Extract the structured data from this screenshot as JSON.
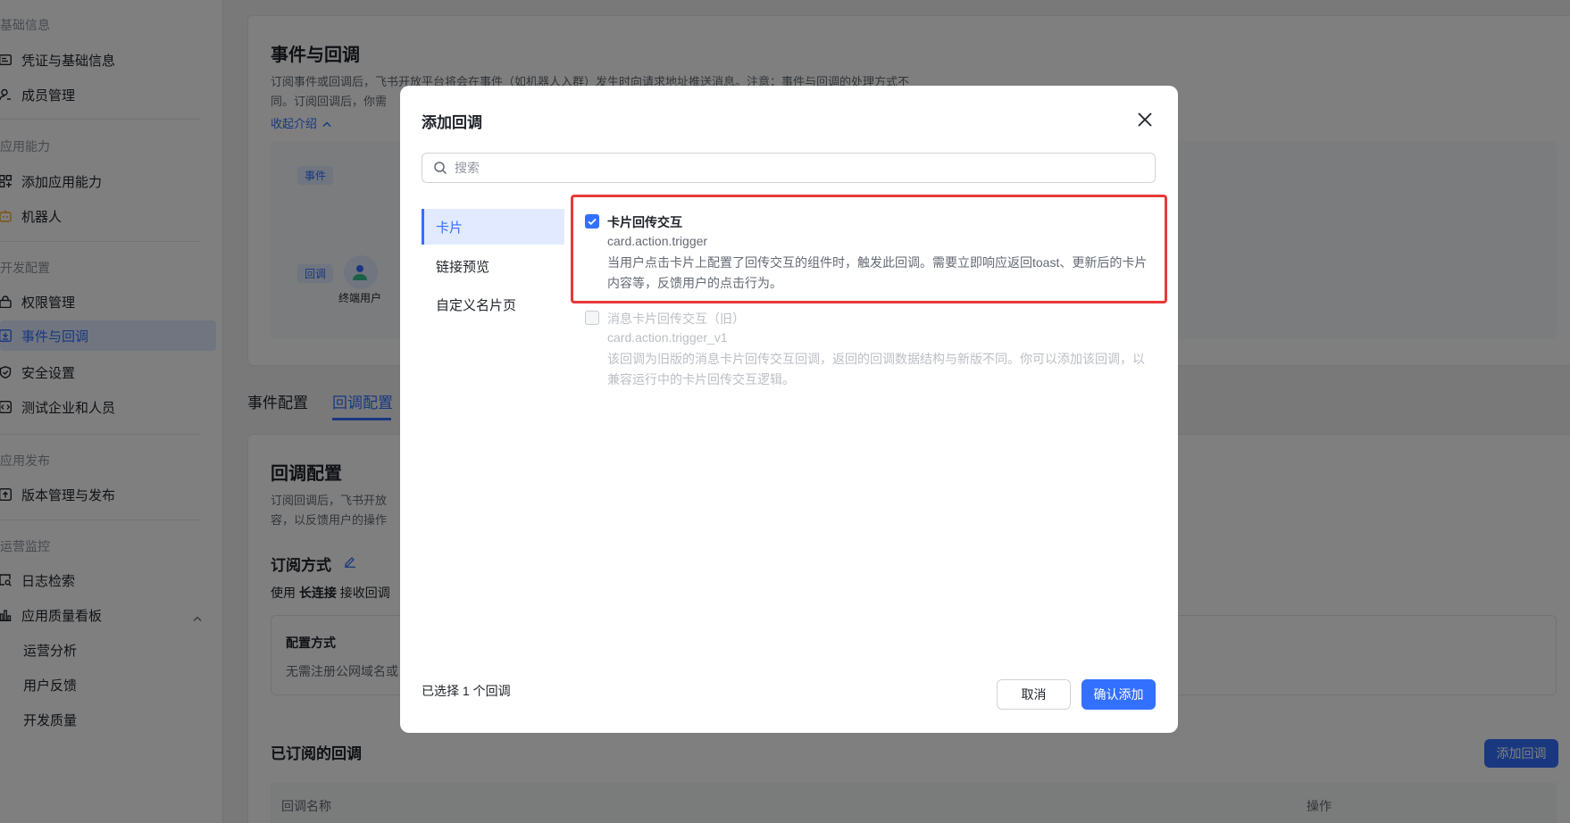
{
  "sidebar": {
    "groups": [
      {
        "label": "基础信息",
        "items": [
          {
            "label": "凭证与基础信息",
            "icon": "id-card-icon"
          },
          {
            "label": "成员管理",
            "icon": "user-icon"
          }
        ]
      },
      {
        "label": "应用能力",
        "items": [
          {
            "label": "添加应用能力",
            "icon": "apps-icon"
          },
          {
            "label": "机器人",
            "icon": "robot-icon"
          }
        ]
      },
      {
        "label": "开发配置",
        "items": [
          {
            "label": "权限管理",
            "icon": "lock-icon"
          },
          {
            "label": "事件与回调",
            "icon": "event-icon"
          },
          {
            "label": "安全设置",
            "icon": "shield-icon"
          },
          {
            "label": "测试企业和人员",
            "icon": "code-icon"
          }
        ]
      },
      {
        "label": "应用发布",
        "items": [
          {
            "label": "版本管理与发布",
            "icon": "upload-icon"
          }
        ]
      },
      {
        "label": "运营监控",
        "items": [
          {
            "label": "日志检索",
            "icon": "search-doc-icon"
          },
          {
            "label": "应用质量看板",
            "icon": "bar-chart-icon"
          },
          {
            "label": "运营分析"
          },
          {
            "label": "用户反馈"
          },
          {
            "label": "开发质量"
          }
        ]
      }
    ],
    "active_item": "事件与回调"
  },
  "page": {
    "title": "事件与回调",
    "intro_line1": "订阅事件或回调后，飞书开放平台将会在事件（如机器人入群）发生时向请求地址推送消息。注意：事件与回调的处理方式不",
    "intro_line2": "同。订阅回调后，你需",
    "collapse_link": "收起介绍",
    "diagram_event_tag": "事件",
    "diagram_callback_tag": "回调",
    "diagram_user_label": "终端用户",
    "tabs": [
      "事件配置",
      "回调配置"
    ],
    "active_tab": "回调配置",
    "section_title": "回调配置",
    "section_desc1": "订阅回调后，飞书开放",
    "section_desc2": "容，以反馈用户的操作",
    "subscribe_title": "订阅方式",
    "subscribe_desc_prefix": "使用",
    "subscribe_desc_bold": "长连接",
    "subscribe_desc_suffix": "接收回调",
    "config_title": "配置方式",
    "config_desc": "无需注册公网域名或",
    "subscribed_title": "已订阅的回调",
    "add_callback_button": "添加回调",
    "table_col_name": "回调名称",
    "table_col_action": "操作"
  },
  "modal": {
    "title": "添加回调",
    "search_placeholder": "搜索",
    "categories": [
      "卡片",
      "链接预览",
      "自定义名片页"
    ],
    "active_category": "卡片",
    "options": [
      {
        "title": "卡片回传交互",
        "key": "card.action.trigger",
        "desc": "当用户点击卡片上配置了回传交互的组件时，触发此回调。需要立即响应返回toast、更新后的卡片内容等，反馈用户的点击行为。",
        "checked": true,
        "disabled": false
      },
      {
        "title": "消息卡片回传交互（旧）",
        "key": "card.action.trigger_v1",
        "desc": "该回调为旧版的消息卡片回传交互回调，返回的回调数据结构与新版不同。你可以添加该回调，以兼容运行中的卡片回传交互逻辑。",
        "checked": false,
        "disabled": true
      }
    ],
    "selected_count": "已选择 1 个回调",
    "cancel_label": "取消",
    "confirm_label": "确认添加"
  },
  "colors": {
    "accent": "#3370ff",
    "highlight_border": "#e63939"
  }
}
